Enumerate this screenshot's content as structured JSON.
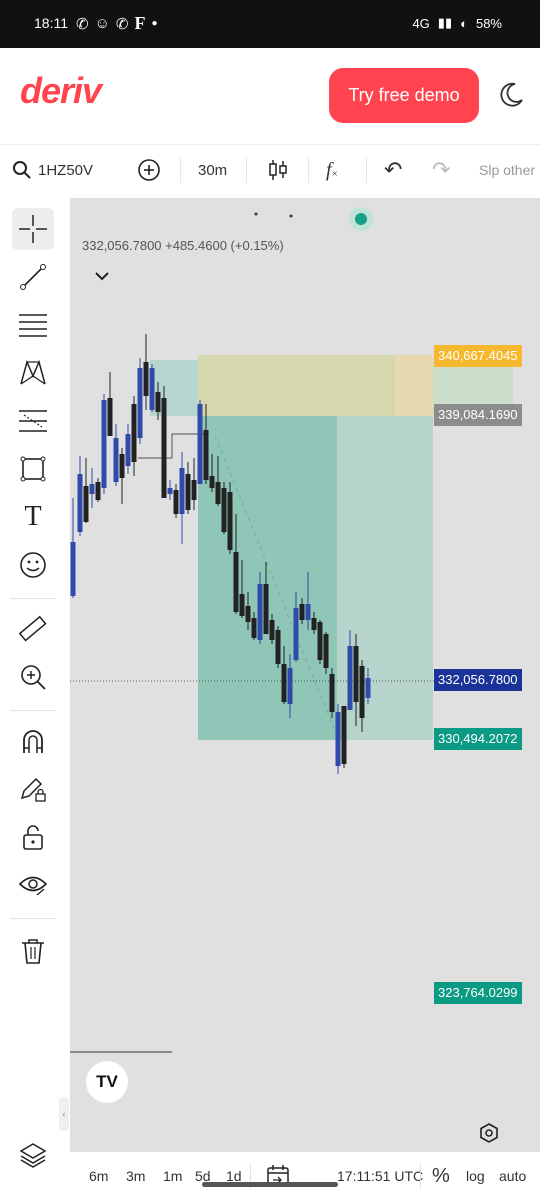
{
  "status_bar": {
    "time": "18:11",
    "left_icons": [
      "whatsapp-icon",
      "snapchat-icon",
      "whatsapp-icon",
      "facebook-icon",
      "dot-icon"
    ],
    "network": "4G",
    "battery": "58%"
  },
  "header": {
    "logo": "deriv",
    "cta_label": "Try free demo",
    "brand_color": "#ff444f"
  },
  "toolbar": {
    "symbol": "1HZ50V",
    "interval": "30m",
    "overflow_text": "Slp other"
  },
  "chart": {
    "ohlc_summary": "332,056.7800  +485.4600 (+0.15%)",
    "price_tags": [
      {
        "text": "340,667.4045",
        "color": "#f5b82e"
      },
      {
        "text": "339,084.1690",
        "color": "#8c8c8c"
      },
      {
        "text": "332,056.7800",
        "color": "#1a3399"
      },
      {
        "text": "330,494.2072",
        "color": "#0b9a83"
      },
      {
        "text": "323,764.0299",
        "color": "#0b9a83"
      }
    ],
    "watermark": "TV"
  },
  "bottom_bar": {
    "ranges": [
      "6m",
      "3m",
      "1m",
      "5d",
      "1d"
    ],
    "clock": "17:11:51 UTC",
    "percent": "%",
    "log": "log",
    "auto": "auto"
  }
}
